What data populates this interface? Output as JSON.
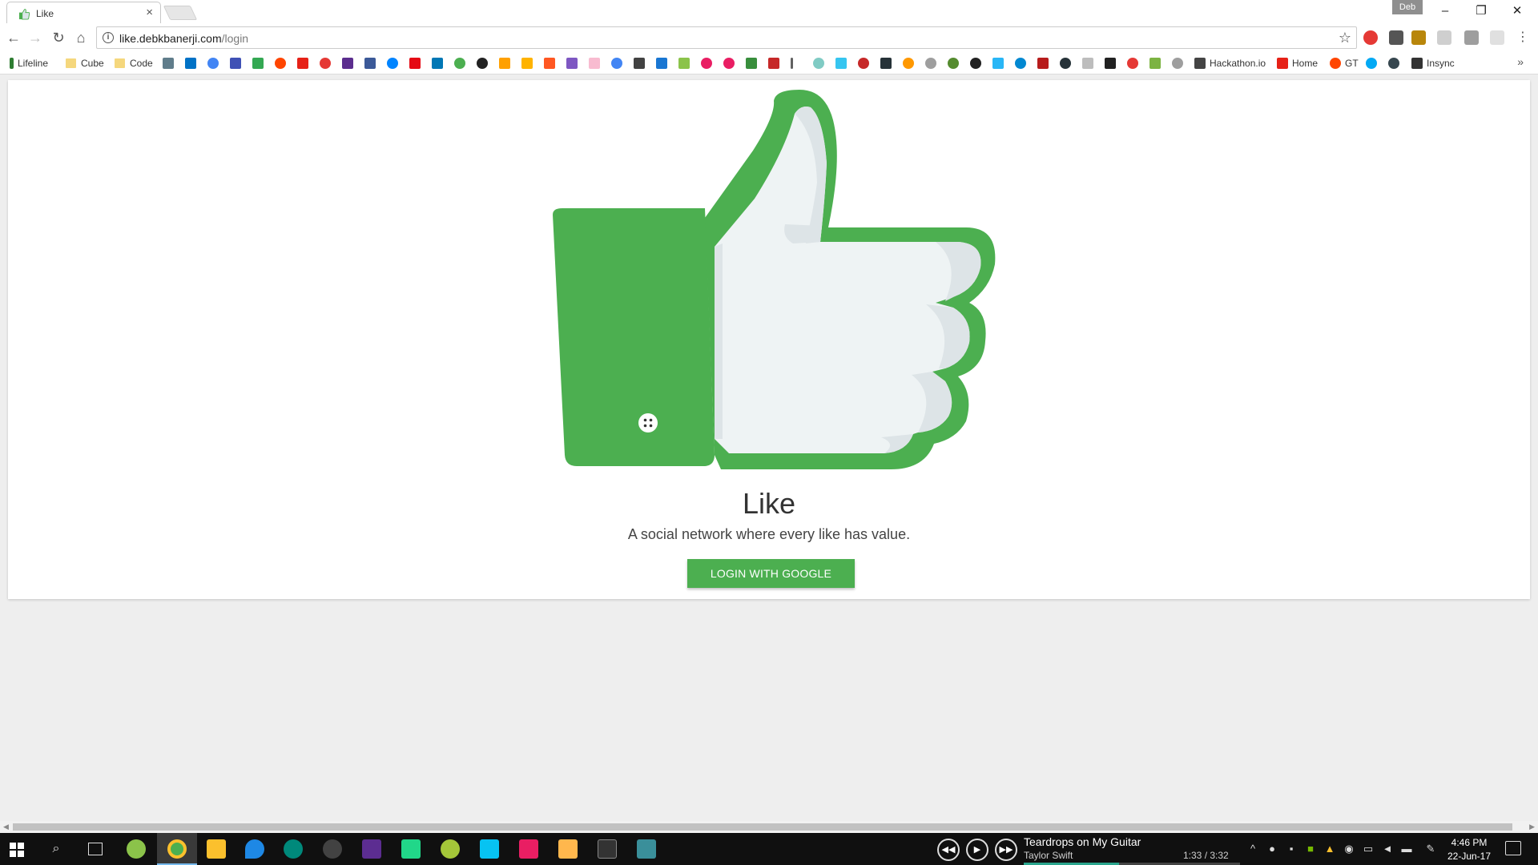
{
  "browser": {
    "tab_title": "Like",
    "tab_close": "×",
    "profile_badge": "Deb",
    "window_buttons": {
      "minimize": "–",
      "restore": "❐",
      "close": "✕"
    },
    "nav": {
      "back": "←",
      "forward": "→",
      "reload": "↻",
      "home": "⌂"
    },
    "url_domain": "like.debkbanerji.com",
    "url_path": "/login",
    "bookmark_star": "☆",
    "bookmarks": [
      {
        "label": "Lifeline",
        "icon": "lifeline-icon",
        "color": "#2e7d32"
      },
      {
        "label": "Cube",
        "icon": "folder-icon",
        "color": "#f5d77d"
      },
      {
        "label": "Code",
        "icon": "folder-icon",
        "color": "#f5d77d"
      }
    ],
    "bookmark_named_right": [
      {
        "label": "Hackathon.io",
        "icon": "hackathon-icon",
        "color": "#444444"
      },
      {
        "label": "Home",
        "icon": "youtube-icon",
        "color": "#e62117"
      },
      {
        "label": "GT",
        "icon": "reddit-icon",
        "color": "#ff4500"
      },
      {
        "label": "Insync",
        "icon": "insync-icon",
        "color": "#333333"
      }
    ],
    "bookmark_more": "»"
  },
  "page": {
    "app_title": "Like",
    "app_subtitle": "A social network where every like has value.",
    "login_button": "LOGIN WITH GOOGLE",
    "brand_color": "#4caf50"
  },
  "taskbar": {
    "media": {
      "title": "Teardrops on My Guitar",
      "artist": "Taylor Swift",
      "time": "1:33 / 3:32",
      "progress_fraction": 0.44
    },
    "clock_time": "4:46 PM",
    "clock_date": "22-Jun-17"
  }
}
